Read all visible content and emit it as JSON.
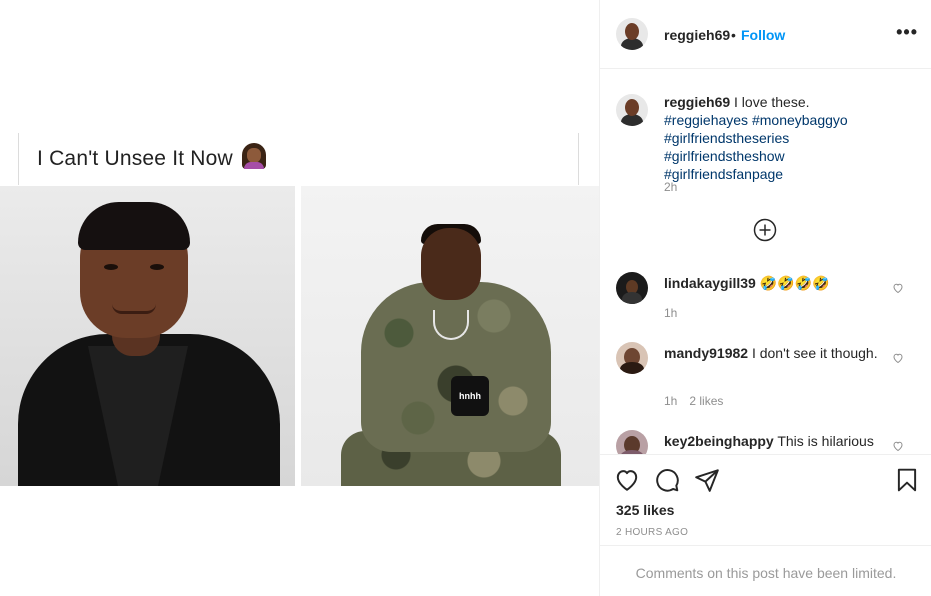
{
  "post_image": {
    "caption_text": "I Can't Unsee It Now",
    "caption_emoji": "woman-facepalming-emoji",
    "mic_label": "hnhh"
  },
  "header": {
    "username": "reggieh69",
    "separator": "•",
    "follow_label": "Follow",
    "more_label": "•••"
  },
  "caption": {
    "username": "reggieh69",
    "text": "I love these.",
    "hashtags": [
      "#reggiehayes",
      "#moneybaggyo",
      "#girlfriendstheseries",
      "#girlfriendstheshow",
      "#girlfriendsfanpage"
    ],
    "time": "2h"
  },
  "comments": [
    {
      "username": "lindakaygill39",
      "text": "🤣🤣🤣🤣",
      "time": "1h",
      "likes": ""
    },
    {
      "username": "mandy91982",
      "text": "I don't see it though.",
      "time": "1h",
      "likes": "2 likes"
    },
    {
      "username": "key2beinghappy",
      "text": "This is hilarious",
      "time": "",
      "likes": ""
    }
  ],
  "actions": {
    "likes_count": "325 likes",
    "time_ago": "2 HOURS AGO"
  },
  "footer": {
    "limited_text": "Comments on this post have been limited."
  },
  "colors": {
    "accent": "#0095f6",
    "hashtag": "#00376b",
    "muted": "#8e8e8e"
  }
}
